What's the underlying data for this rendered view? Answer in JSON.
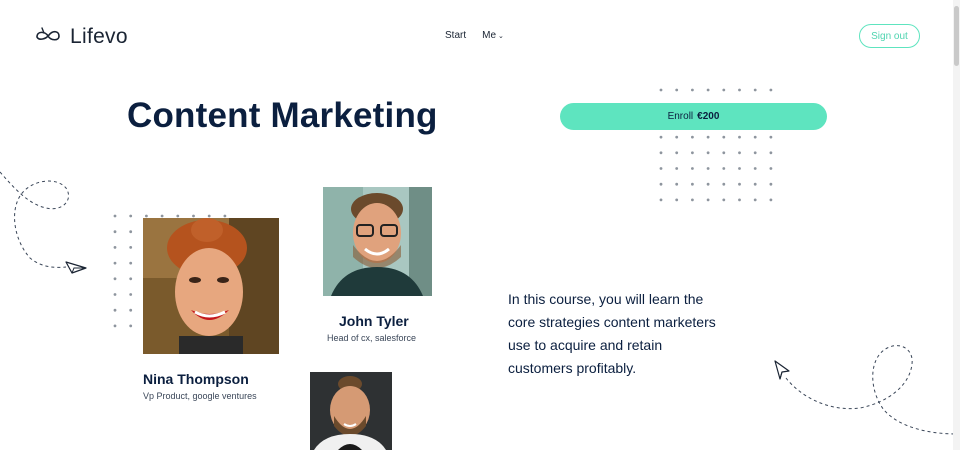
{
  "header": {
    "logo_text": "Lifevo",
    "nav": [
      {
        "label": "Start"
      },
      {
        "label": "Me",
        "has_dropdown": true
      }
    ],
    "sign_out_label": "Sign out"
  },
  "course": {
    "title": "Content Marketing",
    "enroll_label": "Enroll",
    "enroll_price": "€200",
    "description": "In this course, you will learn the core strategies content marketers use to acquire and retain customers profitably."
  },
  "instructors": [
    {
      "name": "Nina Thompson",
      "role": "Vp Product, google ventures"
    },
    {
      "name": "John Tyler",
      "role": "Head of cx, salesforce"
    },
    {
      "name": "",
      "role": ""
    }
  ],
  "colors": {
    "accent": "#5ee4bf",
    "heading": "#0b1f3f",
    "body_text": "#0b1f3f",
    "dots": "#9aa1ab"
  },
  "icons": [
    "logo-infinity-icon",
    "chevron-down-icon",
    "paper-plane-icon",
    "cursor-arrow-icon"
  ]
}
